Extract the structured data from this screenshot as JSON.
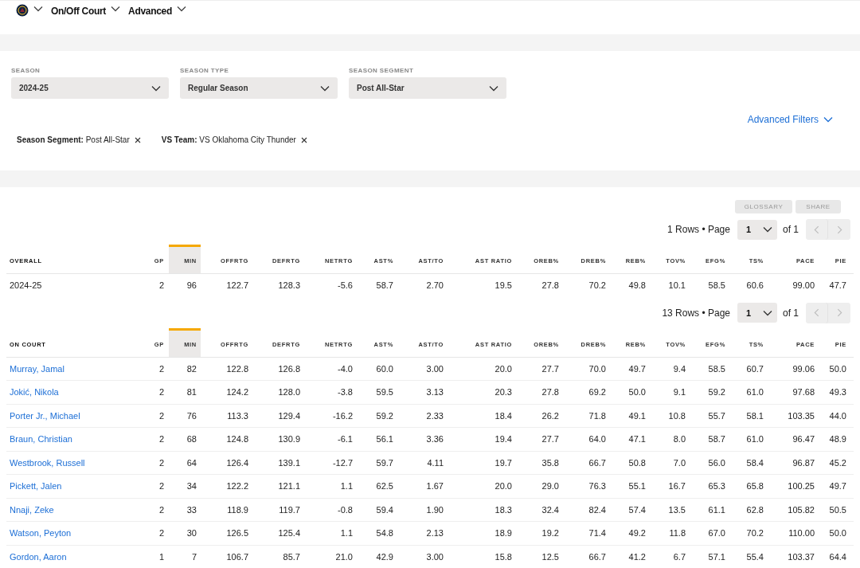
{
  "nav_items": [
    {
      "label": "On/Off Court"
    },
    {
      "label": "Advanced"
    }
  ],
  "filters": [
    {
      "label": "SEASON",
      "value": "2024-25"
    },
    {
      "label": "SEASON TYPE",
      "value": "Regular Season"
    },
    {
      "label": "SEASON SEGMENT",
      "value": "Post All-Star"
    }
  ],
  "advanced_filters_link": "Advanced Filters",
  "chips": [
    {
      "text": "**Season Segment:** Post All-Star"
    },
    {
      "text": "**VS Team:** VS Oklahoma City Thunder"
    }
  ],
  "buttons": [
    "GLOSSARY",
    "SHARE"
  ],
  "tables": [
    {
      "pager": {
        "rows_text": "1 Rows • Page",
        "page": "1",
        "of_text": "of 1"
      },
      "columns": [
        {
          "label": "OVERALL",
          "sorted": false
        },
        {
          "label": "GP",
          "sorted": false
        },
        {
          "label": "MIN",
          "sorted": true
        },
        {
          "label": "OFFRTG",
          "sorted": false
        },
        {
          "label": "DEFRTG",
          "sorted": false
        },
        {
          "label": "NETRTG",
          "sorted": false
        },
        {
          "label": "AST%",
          "sorted": false
        },
        {
          "label": "AST/TO",
          "sorted": false
        },
        {
          "label": "AST RATIO",
          "sorted": false
        },
        {
          "label": "OREB%",
          "sorted": false
        },
        {
          "label": "DREB%",
          "sorted": false
        },
        {
          "label": "REB%",
          "sorted": false
        },
        {
          "label": "TOV%",
          "sorted": false
        },
        {
          "label": "EFG%",
          "sorted": false
        },
        {
          "label": "TS%",
          "sorted": false
        },
        {
          "label": "PACE",
          "sorted": false
        },
        {
          "label": "PIE",
          "sorted": false
        }
      ],
      "rows": [
        {
          "link": false,
          "cells": [
            "2024-25",
            "2",
            "96",
            "122.7",
            "128.3",
            "-5.6",
            "58.7",
            "2.70",
            "19.5",
            "27.8",
            "70.2",
            "49.8",
            "10.1",
            "58.5",
            "60.6",
            "99.00",
            "47.7"
          ]
        }
      ]
    },
    {
      "pager": {
        "rows_text": "13 Rows • Page",
        "page": "1",
        "of_text": "of 1"
      },
      "columns": [
        {
          "label": "ON COURT",
          "sorted": false
        },
        {
          "label": "GP",
          "sorted": false
        },
        {
          "label": "MIN",
          "sorted": true
        },
        {
          "label": "OFFRTG",
          "sorted": false
        },
        {
          "label": "DEFRTG",
          "sorted": false
        },
        {
          "label": "NETRTG",
          "sorted": false
        },
        {
          "label": "AST%",
          "sorted": false
        },
        {
          "label": "AST/TO",
          "sorted": false
        },
        {
          "label": "AST RATIO",
          "sorted": false
        },
        {
          "label": "OREB%",
          "sorted": false
        },
        {
          "label": "DREB%",
          "sorted": false
        },
        {
          "label": "REB%",
          "sorted": false
        },
        {
          "label": "TOV%",
          "sorted": false
        },
        {
          "label": "EFG%",
          "sorted": false
        },
        {
          "label": "TS%",
          "sorted": false
        },
        {
          "label": "PACE",
          "sorted": false
        },
        {
          "label": "PIE",
          "sorted": false
        }
      ],
      "rows": [
        {
          "link": true,
          "cells": [
            "Murray, Jamal",
            "2",
            "82",
            "122.8",
            "126.8",
            "-4.0",
            "60.0",
            "3.00",
            "20.0",
            "27.7",
            "70.0",
            "49.7",
            "9.4",
            "58.5",
            "60.7",
            "99.06",
            "50.0"
          ]
        },
        {
          "link": true,
          "cells": [
            "Jokić, Nikola",
            "2",
            "81",
            "124.2",
            "128.0",
            "-3.8",
            "59.5",
            "3.13",
            "20.3",
            "27.8",
            "69.2",
            "50.0",
            "9.1",
            "59.2",
            "61.0",
            "97.68",
            "49.3"
          ]
        },
        {
          "link": true,
          "cells": [
            "Porter Jr., Michael",
            "2",
            "76",
            "113.3",
            "129.4",
            "-16.2",
            "59.2",
            "2.33",
            "18.4",
            "26.2",
            "71.8",
            "49.1",
            "10.8",
            "55.7",
            "58.1",
            "103.35",
            "44.0"
          ]
        },
        {
          "link": true,
          "cells": [
            "Braun, Christian",
            "2",
            "68",
            "124.8",
            "130.9",
            "-6.1",
            "56.1",
            "3.36",
            "19.4",
            "27.7",
            "64.0",
            "47.1",
            "8.0",
            "58.7",
            "61.0",
            "96.47",
            "48.9"
          ]
        },
        {
          "link": true,
          "cells": [
            "Westbrook, Russell",
            "2",
            "64",
            "126.4",
            "139.1",
            "-12.7",
            "59.7",
            "4.11",
            "19.7",
            "35.8",
            "66.7",
            "50.8",
            "7.0",
            "56.0",
            "58.4",
            "96.87",
            "45.2"
          ]
        },
        {
          "link": true,
          "cells": [
            "Pickett, Jalen",
            "2",
            "34",
            "122.2",
            "121.1",
            "1.1",
            "62.5",
            "1.67",
            "20.0",
            "29.0",
            "76.3",
            "55.1",
            "16.7",
            "65.3",
            "65.8",
            "100.25",
            "49.7"
          ]
        },
        {
          "link": true,
          "cells": [
            "Nnaji, Zeke",
            "2",
            "33",
            "118.9",
            "119.7",
            "-0.8",
            "59.4",
            "1.90",
            "18.3",
            "32.4",
            "82.4",
            "57.4",
            "13.5",
            "61.1",
            "62.8",
            "105.82",
            "50.5"
          ]
        },
        {
          "link": true,
          "cells": [
            "Watson, Peyton",
            "2",
            "30",
            "126.5",
            "125.4",
            "1.1",
            "54.8",
            "2.13",
            "18.9",
            "19.2",
            "71.4",
            "49.2",
            "11.8",
            "67.0",
            "70.2",
            "110.00",
            "50.0"
          ]
        },
        {
          "link": true,
          "cells": [
            "Gordon, Aaron",
            "1",
            "7",
            "106.7",
            "85.7",
            "21.0",
            "42.9",
            "3.00",
            "15.8",
            "12.5",
            "66.7",
            "41.2",
            "6.7",
            "57.1",
            "55.4",
            "103.37",
            "64.4"
          ]
        }
      ]
    }
  ]
}
